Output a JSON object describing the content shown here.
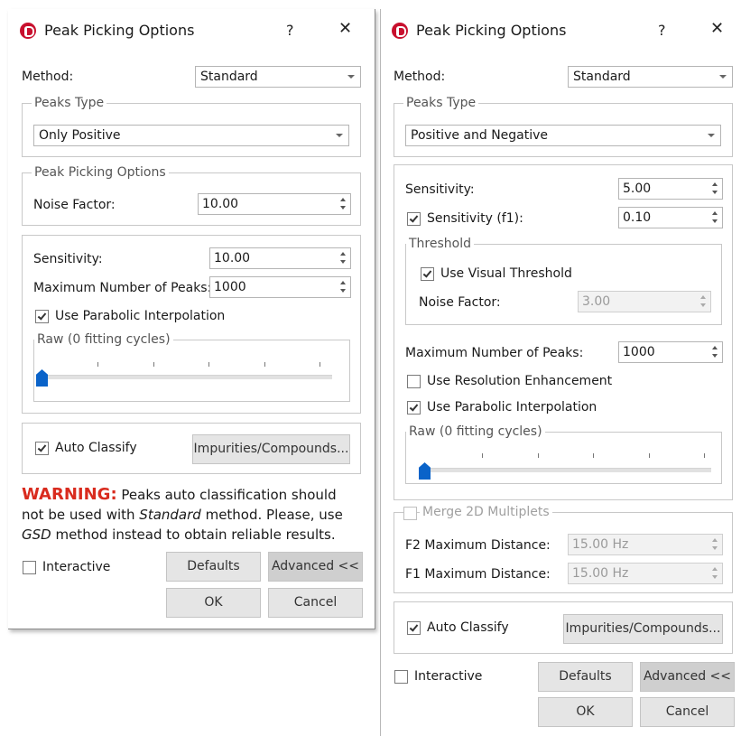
{
  "left_dialog": {
    "title": "Peak Picking Options",
    "help": "?",
    "close": "✕",
    "method_label": "Method:",
    "method_value": "Standard",
    "peaks_type_legend": "Peaks Type",
    "peaks_type_value": "Only Positive",
    "options_legend": "Peak Picking Options",
    "noise_factor_label": "Noise Factor:",
    "noise_factor_value": "10.00",
    "sensitivity_label": "Sensitivity:",
    "sensitivity_value": "10.00",
    "max_peaks_label": "Maximum Number of Peaks:",
    "max_peaks_value": "1000",
    "parabolic_label": "Use Parabolic Interpolation",
    "parabolic_checked": true,
    "raw_legend": "Raw (0 fitting cycles)",
    "slider_value": 0,
    "auto_classify_label": "Auto Classify",
    "auto_classify_checked": true,
    "impurities_button": "Impurities/Compounds...",
    "warning_label": "WARNING:",
    "warning_text_1": " Peaks auto classification should",
    "warning_text_2a": "not be used with ",
    "warning_text_2b": "Standard",
    "warning_text_2c": " method. Please, use",
    "warning_text_3a": "GSD",
    "warning_text_3b": " method instead to obtain reliable results.",
    "interactive_label": "Interactive",
    "interactive_checked": false,
    "defaults_button": "Defaults",
    "advanced_button": "Advanced <<",
    "ok_button": "OK",
    "cancel_button": "Cancel"
  },
  "right_dialog": {
    "title": "Peak Picking Options",
    "help": "?",
    "close": "✕",
    "method_label": "Method:",
    "method_value": "Standard",
    "peaks_type_legend": "Peaks Type",
    "peaks_type_value": "Positive and Negative",
    "sensitivity_label": "Sensitivity:",
    "sensitivity_value": "5.00",
    "sensitivity_f1_label": "Sensitivity (f1):",
    "sensitivity_f1_checked": true,
    "sensitivity_f1_value": "0.10",
    "threshold_legend": "Threshold",
    "visual_threshold_label": "Use Visual Threshold",
    "visual_threshold_checked": true,
    "noise_factor_label": "Noise Factor:",
    "noise_factor_value": "3.00",
    "max_peaks_label": "Maximum Number of Peaks:",
    "max_peaks_value": "1000",
    "resolution_label": "Use Resolution Enhancement",
    "resolution_checked": false,
    "parabolic_label": "Use Parabolic Interpolation",
    "parabolic_checked": true,
    "raw_legend": "Raw (0 fitting cycles)",
    "slider_value": 0,
    "merge_label": "Merge 2D Multiplets",
    "merge_checked": false,
    "f2_label": "F2 Maximum Distance:",
    "f2_value": "15.00 Hz",
    "f1_label": "F1 Maximum Distance:",
    "f1_value": "15.00 Hz",
    "auto_classify_label": "Auto Classify",
    "auto_classify_checked": true,
    "impurities_button": "Impurities/Compounds...",
    "interactive_label": "Interactive",
    "interactive_checked": false,
    "defaults_button": "Defaults",
    "advanced_button": "Advanced <<",
    "ok_button": "OK",
    "cancel_button": "Cancel"
  },
  "colors": {
    "logo": "#c8102e",
    "warning": "#d92b1e",
    "slider_thumb": "#0a63c9"
  }
}
